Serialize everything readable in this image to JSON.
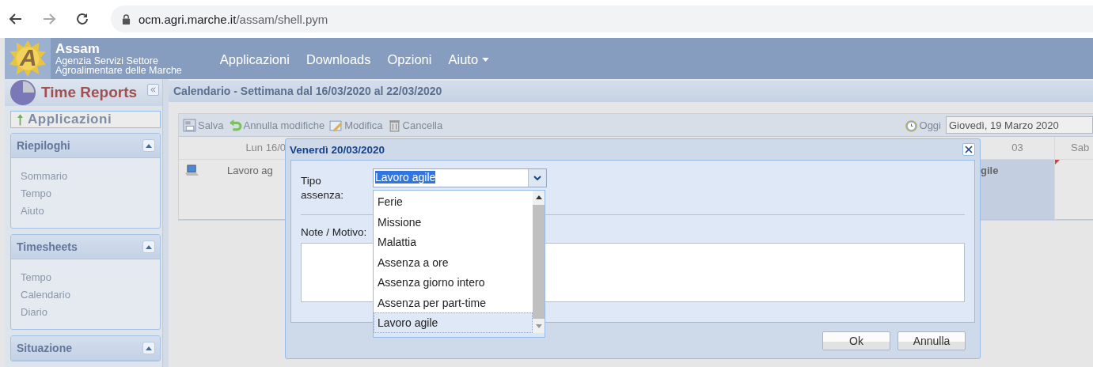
{
  "browser": {
    "url_host": "ocm.agri.marche.it",
    "url_path": "/assam/shell.pym"
  },
  "header": {
    "logo_letter": "A",
    "title": "Assam",
    "subtitle_lines": [
      "Agenzia Servizi Settore",
      "Agroalimentare delle Marche"
    ],
    "menu": [
      {
        "label": "Applicazioni",
        "has_dropdown": false
      },
      {
        "label": "Downloads",
        "has_dropdown": false
      },
      {
        "label": "Opzioni",
        "has_dropdown": false
      },
      {
        "label": "Aiuto",
        "has_dropdown": true
      }
    ]
  },
  "sidebar": {
    "title": "Time Reports",
    "applications_label": "Applicazioni",
    "panels": [
      {
        "title": "Riepiloghi",
        "items": [
          "Sommario",
          "Tempo",
          "Aiuto"
        ]
      },
      {
        "title": "Timesheets",
        "items": [
          "Tempo",
          "Calendario",
          "Diario"
        ]
      },
      {
        "title": "Situazione"
      }
    ]
  },
  "main": {
    "title": "Calendario - Settimana dal 16/03/2020 al 22/03/2020",
    "toolbar": [
      {
        "kind": "save",
        "label": "Salva"
      },
      {
        "kind": "undo",
        "label": "Annulla modifiche"
      },
      {
        "kind": "edit",
        "label": "Modifica"
      },
      {
        "kind": "delete",
        "label": "Cancella"
      }
    ],
    "today_label": "Oggi",
    "today_value": "Giovedì, 19 Marzo 2020",
    "calendar": {
      "columns": [
        "Lun 16/0",
        "03",
        "Sab"
      ],
      "cells": [
        {
          "text": "Lavoro ag",
          "selected": false
        },
        {
          "text": "gile",
          "selected": true
        },
        {
          "selected": false,
          "flagged": true
        }
      ]
    }
  },
  "dialog": {
    "title": "Venerdì 20/03/2020",
    "type_label": "Tipo assenza:",
    "type_value": "Lavoro agile",
    "options": [
      {
        "label": "Ferie",
        "selected": false
      },
      {
        "label": "Missione",
        "selected": false
      },
      {
        "label": "Malattia",
        "selected": false
      },
      {
        "label": "Assenza a ore",
        "selected": false
      },
      {
        "label": "Assenza giorno intero",
        "selected": false
      },
      {
        "label": "Assenza per part-time",
        "selected": false
      },
      {
        "label": "Lavoro agile",
        "selected": true
      }
    ],
    "notes_label": "Note / Motivo:",
    "buttons": [
      "Ok",
      "Annulla"
    ]
  }
}
